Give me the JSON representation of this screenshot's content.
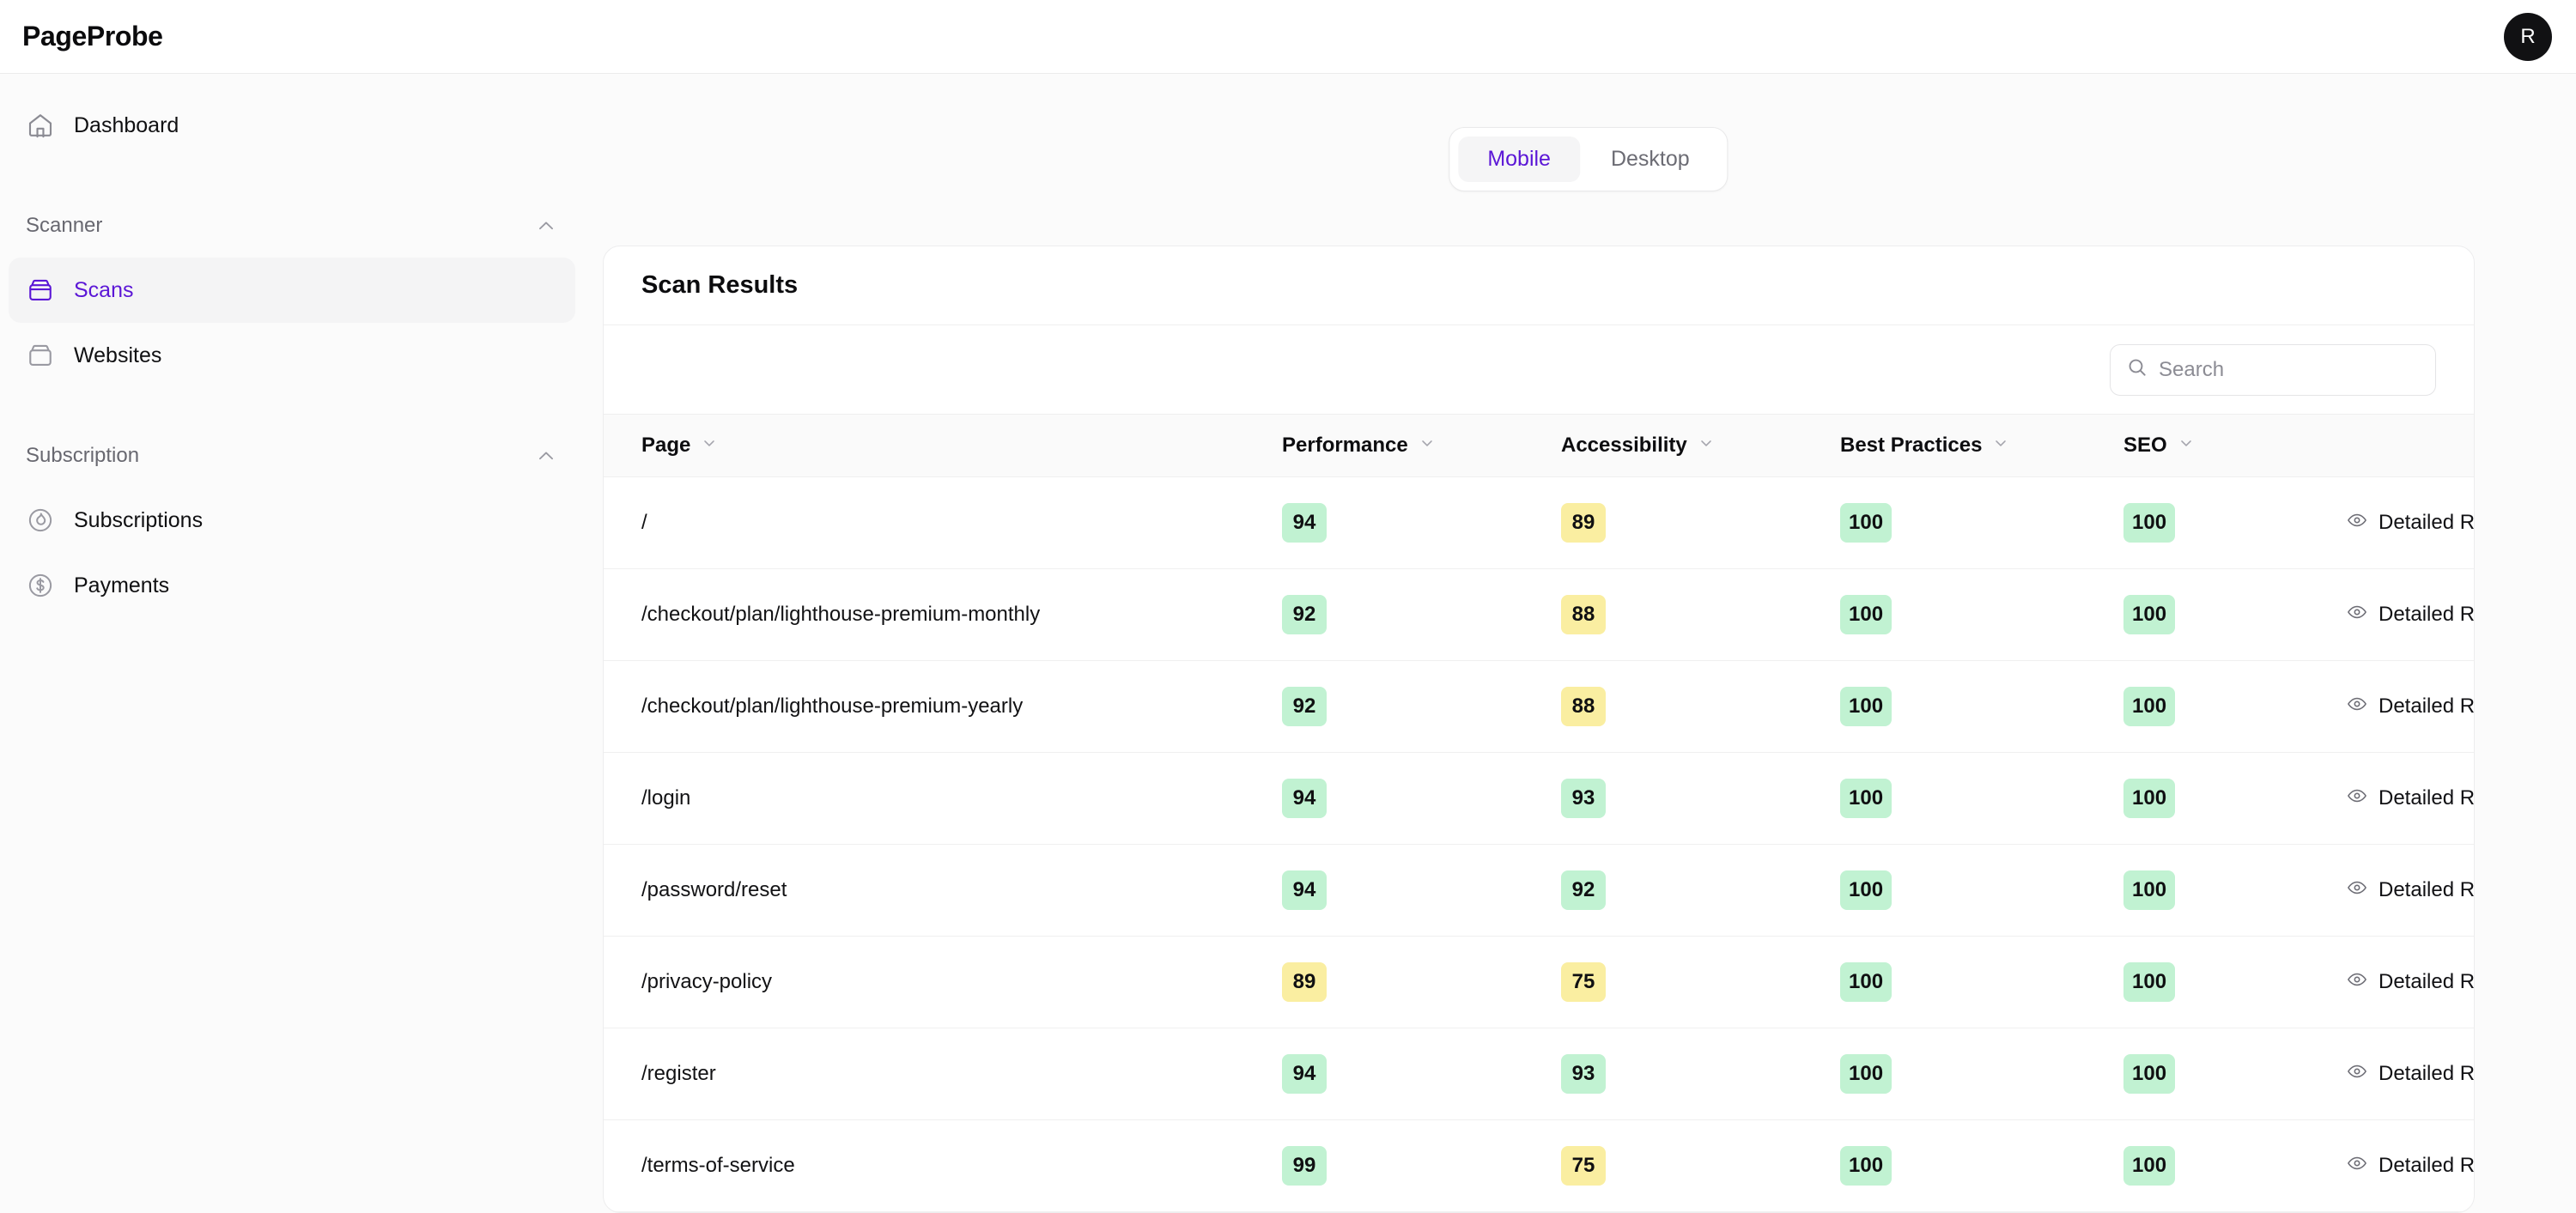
{
  "header": {
    "brand": "PageProbe",
    "avatar_initial": "R"
  },
  "sidebar": {
    "primary": [
      {
        "label": "Dashboard",
        "icon": "home-icon",
        "active": false
      }
    ],
    "groups": [
      {
        "label": "Scanner",
        "collapse_icon": "chevron-up-icon",
        "items": [
          {
            "label": "Scans",
            "icon": "archive-box-icon",
            "active": true
          },
          {
            "label": "Websites",
            "icon": "archive-box-icon",
            "active": false
          }
        ]
      },
      {
        "label": "Subscription",
        "collapse_icon": "chevron-up-icon",
        "items": [
          {
            "label": "Subscriptions",
            "icon": "flame-circle-icon",
            "active": false
          },
          {
            "label": "Payments",
            "icon": "dollar-circle-icon",
            "active": false
          }
        ]
      }
    ]
  },
  "device_toggle": {
    "options": [
      "Mobile",
      "Desktop"
    ],
    "selected": "Mobile"
  },
  "card": {
    "title": "Scan Results",
    "search": {
      "placeholder": "Search",
      "value": "",
      "icon": "search-icon"
    },
    "columns": [
      {
        "key": "page",
        "label": "Page",
        "sort_icon": "chevron-down-icon"
      },
      {
        "key": "performance",
        "label": "Performance",
        "sort_icon": "chevron-down-icon"
      },
      {
        "key": "accessibility",
        "label": "Accessibility",
        "sort_icon": "chevron-down-icon"
      },
      {
        "key": "best_practices",
        "label": "Best Practices",
        "sort_icon": "chevron-down-icon"
      },
      {
        "key": "seo",
        "label": "SEO",
        "sort_icon": "chevron-down-icon"
      },
      {
        "key": "actions",
        "label": "",
        "sort_icon": ""
      }
    ],
    "action_label": "Detailed Report",
    "action_icon": "eye-icon",
    "rows": [
      {
        "page": "/",
        "performance": "94",
        "performance_state": "good",
        "accessibility": "89",
        "accessibility_state": "warn",
        "best_practices": "100",
        "best_practices_state": "good",
        "seo": "100",
        "seo_state": "good"
      },
      {
        "page": "/checkout/plan/lighthouse-premium-monthly",
        "performance": "92",
        "performance_state": "good",
        "accessibility": "88",
        "accessibility_state": "warn",
        "best_practices": "100",
        "best_practices_state": "good",
        "seo": "100",
        "seo_state": "good"
      },
      {
        "page": "/checkout/plan/lighthouse-premium-yearly",
        "performance": "92",
        "performance_state": "good",
        "accessibility": "88",
        "accessibility_state": "warn",
        "best_practices": "100",
        "best_practices_state": "good",
        "seo": "100",
        "seo_state": "good"
      },
      {
        "page": "/login",
        "performance": "94",
        "performance_state": "good",
        "accessibility": "93",
        "accessibility_state": "good",
        "best_practices": "100",
        "best_practices_state": "good",
        "seo": "100",
        "seo_state": "good"
      },
      {
        "page": "/password/reset",
        "performance": "94",
        "performance_state": "good",
        "accessibility": "92",
        "accessibility_state": "good",
        "best_practices": "100",
        "best_practices_state": "good",
        "seo": "100",
        "seo_state": "good"
      },
      {
        "page": "/privacy-policy",
        "performance": "89",
        "performance_state": "warn",
        "accessibility": "75",
        "accessibility_state": "warn",
        "best_practices": "100",
        "best_practices_state": "good",
        "seo": "100",
        "seo_state": "good"
      },
      {
        "page": "/register",
        "performance": "94",
        "performance_state": "good",
        "accessibility": "93",
        "accessibility_state": "good",
        "best_practices": "100",
        "best_practices_state": "good",
        "seo": "100",
        "seo_state": "good"
      },
      {
        "page": "/terms-of-service",
        "performance": "99",
        "performance_state": "good",
        "accessibility": "75",
        "accessibility_state": "warn",
        "best_practices": "100",
        "best_practices_state": "good",
        "seo": "100",
        "seo_state": "good"
      }
    ]
  },
  "colors": {
    "accent": "#5b16d6",
    "badge_good": "#c1f2d2",
    "badge_warn": "#faeea1",
    "page_bg": "#fbfbfb",
    "card_bg": "#ffffff"
  }
}
